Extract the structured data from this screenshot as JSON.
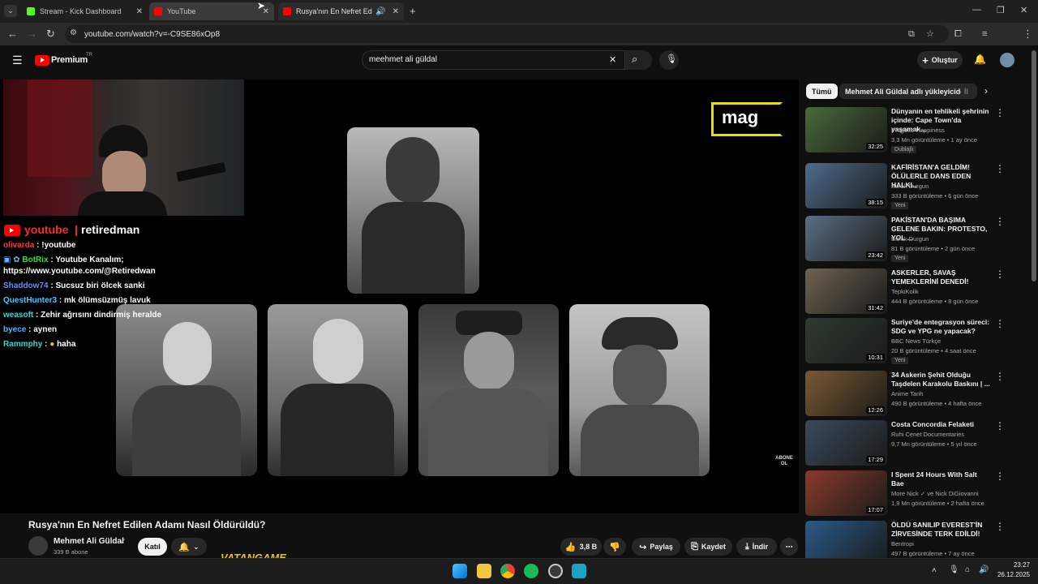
{
  "browser": {
    "tabs": [
      {
        "title": "Stream - Kick Dashboard",
        "fav_color": "#53fc18",
        "active": false
      },
      {
        "title": "YouTube",
        "fav_color": "#ff0000",
        "active": false
      },
      {
        "title": "Rusya'nın En Nefret Edilen",
        "fav_color": "#ff0000",
        "active": true
      }
    ],
    "new_tab": "+",
    "url": "youtube.com/watch?v=-C9SE86xOp8"
  },
  "youtube": {
    "logo_text": "Premium",
    "logo_region": "TR",
    "search_query": "meehmet ali güldal",
    "create_label": "Oluştur"
  },
  "stream_overlay": {
    "brand_left": "youtube",
    "brand_right": "retiredman",
    "chat": [
      {
        "user": "olivarda",
        "user_color": "#ff3a3a",
        "msg": "!youtube"
      },
      {
        "user": "BotRix",
        "user_color": "#3adc3a",
        "msg": "Youtube Kanalım;"
      },
      {
        "user": "",
        "user_color": "#ffffff",
        "msg": "https://www.youtube.com/@Retiredwan"
      },
      {
        "user": "Shaddow74",
        "user_color": "#6a8cff",
        "msg": "Sucsuz biri ölcek sanki"
      },
      {
        "user": "QuestHunter3",
        "user_color": "#4dc8ff",
        "msg": "mk ölümsüzmüş lavuk"
      },
      {
        "user": "weasoft",
        "user_color": "#3ad6c8",
        "msg": "Zehir ağrısını dindirmiş heralde"
      },
      {
        "user": "byece",
        "user_color": "#4db8ff",
        "msg": "aynen"
      },
      {
        "user": "Rammphy",
        "user_color": "#3ad6c8",
        "msg": "haha"
      }
    ],
    "mag_label": "mag",
    "subscribe_label": "ABONE OL"
  },
  "video": {
    "title": "Rusya'nın En Nefret Edilen Adamı Nasıl Öldürüldü?",
    "channel": "Mehmet Ali Güldal",
    "subscribers": "339 B abone",
    "join_label": "Katıl",
    "likes": "3,8 B",
    "share_label": "Paylaş",
    "save_label": "Kaydet",
    "download_label": "İndir",
    "watermark": "VATANGAME"
  },
  "sidebar": {
    "chips": [
      "Tümü",
      "Mehmet Ali Güldal adlı yükleyiciden",
      "İl"
    ],
    "recommendations": [
      {
        "title": "Dünyanın en tehlikeli şehrinin içinde: Cape Town'da yaşamak...",
        "channel": "Progetto Happiness",
        "meta": "3,3 Mn görüntüleme • 1 ay önce",
        "badge": "Dublajlı",
        "duration": "32:25",
        "thumb_color": "#4a6a3a"
      },
      {
        "title": "KAFİRİSTAN'A GELDİM! ÖLÜLERLE DANS EDEN HALKI...",
        "channel": "Burak Durgun",
        "meta": "333 B görüntüleme • 6 gün önce",
        "badge": "Yeni",
        "duration": "38:15",
        "thumb_color": "#4f6c8c"
      },
      {
        "title": "PAKİSTAN'DA BAŞIMA GELENE BAKIN: PROTESTO, YOL ...",
        "channel": "Burak Durgun",
        "meta": "81 B görüntüleme • 2 gün önce",
        "badge": "Yeni",
        "duration": "23:42",
        "thumb_color": "#5b6f86"
      },
      {
        "title": "ASKERLER, SAVAŞ YEMEKLERİNİ DENEDİ!",
        "channel": "TepkiKolik",
        "meta": "444 B görüntüleme • 8 gün önce",
        "badge": "",
        "duration": "31:42",
        "thumb_color": "#6f6252"
      },
      {
        "title": "Suriye'de entegrasyon süreci: SDG ve YPG ne yapacak?",
        "channel": "BBC News Türkçe",
        "meta": "20 B görüntüleme • 4 saat önce",
        "badge": "Yeni",
        "duration": "10:31",
        "thumb_color": "#2f3b33"
      },
      {
        "title": "34 Askerin Şehit Olduğu Taşdelen Karakolu Baskını | ...",
        "channel": "Anime Tarih",
        "meta": "490 B görüntüleme • 4 hafta önce",
        "badge": "",
        "duration": "12:26",
        "thumb_color": "#7a5a32"
      },
      {
        "title": "Costa Concordia Felaketi",
        "channel": "Ruhi Cenet Documentaries",
        "meta": "9,7 Mn görüntüleme • 5 yıl önce",
        "badge": "",
        "duration": "17:29",
        "thumb_color": "#3a4a5c"
      },
      {
        "title": "I Spent 24 Hours With Salt Bae",
        "channel": "More Nick ✓ ve Nick DiGiovanni",
        "meta": "1,9 Mn görüntüleme • 2 hafta önce",
        "badge": "",
        "duration": "17:07",
        "thumb_color": "#8a3b2a"
      },
      {
        "title": "ÖLDÜ SANILIP EVEREST'İN ZİRVESİNDE TERK EDİLDİ!",
        "channel": "Bentropi",
        "meta": "497 B görüntüleme • 7 ay önce",
        "badge": "",
        "duration": "",
        "thumb_color": "#2a5a8a"
      }
    ]
  },
  "taskbar": {
    "time": "23:27",
    "date": "26.12.2025"
  }
}
